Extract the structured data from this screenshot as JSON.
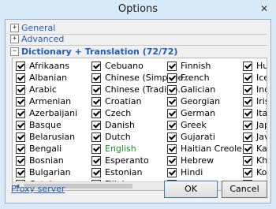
{
  "window": {
    "title": "Options",
    "close_glyph": "✕"
  },
  "sections": {
    "general": {
      "label": "General",
      "expander": "+"
    },
    "advanced": {
      "label": "Advanced",
      "expander": "+"
    },
    "dictionary": {
      "label": "Dictionary + Translation (72/72)",
      "expander": "−"
    }
  },
  "languages": {
    "col1": [
      "Afrikaans",
      "Albanian",
      "Arabic",
      "Armenian",
      "Azerbaijani",
      "Basque",
      "Belarusian",
      "Bengali",
      "Bosnian",
      "Bulgarian",
      "Catalan"
    ],
    "col2": [
      "Cebuano",
      "Chinese (Simplifie…",
      "Chinese (Traditio…",
      "Croatian",
      "Czech",
      "Danish",
      "Dutch",
      "English",
      "Esperanto",
      "Estonian",
      "Filipino"
    ],
    "col3": [
      "Finnish",
      "French",
      "Galician",
      "Georgian",
      "German",
      "Greek",
      "Gujarati",
      "Haitian Creole",
      "Hebrew",
      "Hindi",
      "Hmong"
    ],
    "col4": [
      "Hur",
      "Icela",
      "Indo",
      "Irish",
      "Italia",
      "Japa",
      "Java",
      "Kan",
      "Khm",
      "Kore",
      "Lao"
    ]
  },
  "highlighted_language": "English",
  "footer": {
    "proxy_label": "Proxy server",
    "ok_label": "OK",
    "cancel_label": "Cancel"
  }
}
